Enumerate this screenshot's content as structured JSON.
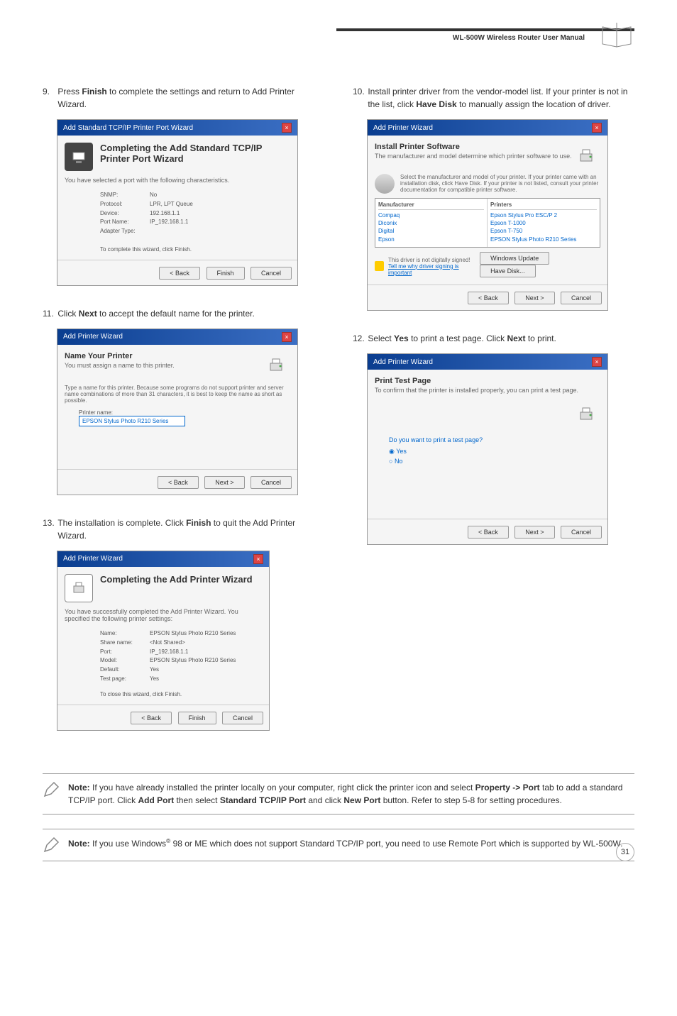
{
  "header": {
    "manual_title": "WL-500W Wireless Router User Manual"
  },
  "left_column": {
    "step9": {
      "num": "9.",
      "text_before": "Press ",
      "bold1": "Finish",
      "text_after": " to complete the settings and return to Add Printer Wizard."
    },
    "step11": {
      "num": "11.",
      "text_before": "Click ",
      "bold1": "Next",
      "text_after": " to accept the default name for the printer."
    },
    "step13": {
      "num": "13.",
      "text_before": "The installation is complete. Click ",
      "bold1": "Finish",
      "text_after": " to quit the Add Printer Wizard."
    }
  },
  "right_column": {
    "step10": {
      "num": "10.",
      "text_before": "Install printer driver from the vendor-model list. If your printer is not in the list, click ",
      "bold1": "Have Disk",
      "text_after": " to manually assign the location of driver."
    },
    "step12": {
      "num": "12.",
      "text_before": "Select ",
      "bold1": "Yes",
      "text_mid": " to print a test page. Click ",
      "bold2": "Next",
      "text_after": " to print."
    }
  },
  "screenshots": {
    "s9": {
      "titlebar": "Add Standard TCP/IP Printer Port Wizard",
      "heading": "Completing the Add Standard TCP/IP Printer Port Wizard",
      "sub": "You have selected a port with the following characteristics.",
      "rows": [
        {
          "lbl": "SNMP:",
          "val": "No"
        },
        {
          "lbl": "Protocol:",
          "val": "LPR, LPT Queue"
        },
        {
          "lbl": "Device:",
          "val": "192.168.1.1"
        },
        {
          "lbl": "Port Name:",
          "val": "IP_192.168.1.1"
        },
        {
          "lbl": "Adapter Type:",
          "val": ""
        }
      ],
      "footer_text": "To complete this wizard, click Finish.",
      "btn_back": "< Back",
      "btn_finish": "Finish",
      "btn_cancel": "Cancel"
    },
    "s10": {
      "titlebar": "Add Printer Wizard",
      "heading": "Install Printer Software",
      "sub": "The manufacturer and model determine which printer software to use.",
      "instruct": "Select the manufacturer and model of your printer. If your printer came with an installation disk, click Have Disk. If your printer is not listed, consult your printer documentation for compatible printer software.",
      "mfr_header": "Manufacturer",
      "prn_header": "Printers",
      "mfr_items": [
        "Compaq",
        "Diconix",
        "Digital",
        "Epson"
      ],
      "prn_items": [
        "Epson Stylus Pro ESC/P 2",
        "Epson T-1000",
        "Epson T-750",
        "EPSON Stylus Photo R210 Series"
      ],
      "warn_text": "This driver is not digitally signed!",
      "link_text": "Tell me why driver signing is important",
      "btn_wu": "Windows Update",
      "btn_hd": "Have Disk...",
      "btn_back": "< Back",
      "btn_next": "Next >",
      "btn_cancel": "Cancel"
    },
    "s11": {
      "titlebar": "Add Printer Wizard",
      "heading": "Name Your Printer",
      "sub": "You must assign a name to this printer.",
      "instruct": "Type a name for this printer. Because some programs do not support printer and server name combinations of more than 31 characters, it is best to keep the name as short as possible.",
      "label": "Printer name:",
      "input_val": "EPSON Stylus Photo R210 Series",
      "btn_back": "< Back",
      "btn_next": "Next >",
      "btn_cancel": "Cancel"
    },
    "s12": {
      "titlebar": "Add Printer Wizard",
      "heading": "Print Test Page",
      "sub": "To confirm that the printer is installed properly, you can print a test page.",
      "question": "Do you want to print a test page?",
      "opt_yes": "Yes",
      "opt_no": "No",
      "btn_back": "< Back",
      "btn_next": "Next >",
      "btn_cancel": "Cancel"
    },
    "s13": {
      "titlebar": "Add Printer Wizard",
      "heading": "Completing the Add Printer Wizard",
      "sub": "You have successfully completed the Add Printer Wizard. You specified the following printer settings:",
      "rows": [
        {
          "lbl": "Name:",
          "val": "EPSON Stylus Photo R210 Series"
        },
        {
          "lbl": "Share name:",
          "val": "<Not Shared>"
        },
        {
          "lbl": "Port:",
          "val": "IP_192.168.1.1"
        },
        {
          "lbl": "Model:",
          "val": "EPSON Stylus Photo R210 Series"
        },
        {
          "lbl": "Default:",
          "val": "Yes"
        },
        {
          "lbl": "Test page:",
          "val": "Yes"
        }
      ],
      "footer_text": "To close this wizard, click Finish.",
      "btn_back": "< Back",
      "btn_finish": "Finish",
      "btn_cancel": "Cancel"
    }
  },
  "notes": {
    "note1": {
      "bold": "Note:",
      "text": " If you have already installed the printer locally on your computer, right click the printer icon and select ",
      "b1": "Property -> Port",
      "t1": " tab to add a standard TCP/IP port. Click ",
      "b2": "Add Port",
      "t2": " then select ",
      "b3": "Standard TCP/IP Port",
      "t3": " and click ",
      "b4": "New Port",
      "t4": " button. Refer to step 5-8 for setting procedures."
    },
    "note2": {
      "bold": "Note:",
      "text": " If you use Windows",
      "sup": "®",
      "t1": " 98 or ME which does not support Standard TCP/IP port, you need to use Remote Port which is supported by WL-500W."
    }
  },
  "page_number": "31"
}
